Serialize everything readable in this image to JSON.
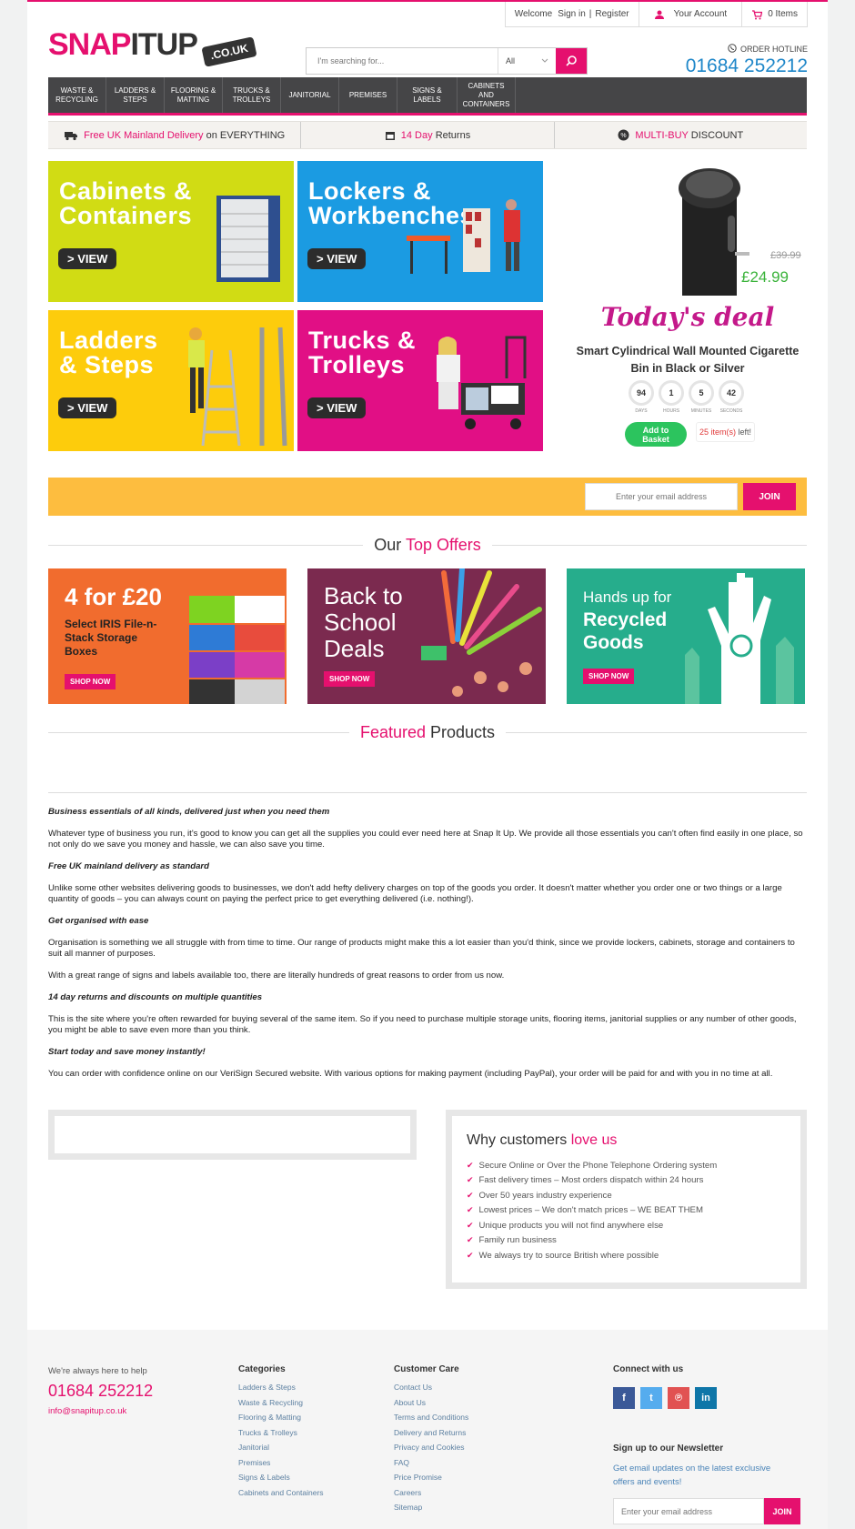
{
  "topbar": {
    "welcome": "Welcome",
    "sign_in": "Sign in",
    "sep": "|",
    "register": "Register",
    "account": "Your Account",
    "basket": "0 Items"
  },
  "logo": {
    "text_pink": "SNAP",
    "text_dark": "ITUP",
    "tag": ".CO.UK"
  },
  "search": {
    "placeholder": "I'm searching for...",
    "category": "All"
  },
  "hotline": {
    "label": "ORDER HOTLINE",
    "number": "01684 252212"
  },
  "nav": [
    {
      "l1": "WASTE &",
      "l2": "RECYCLING"
    },
    {
      "l1": "LADDERS &",
      "l2": "STEPS"
    },
    {
      "l1": "FLOORING &",
      "l2": "MATTING"
    },
    {
      "l1": "TRUCKS &",
      "l2": "TROLLEYS"
    },
    {
      "l1": "JANITORIAL",
      "l2": ""
    },
    {
      "l1": "PREMISES",
      "l2": ""
    },
    {
      "l1": "SIGNS & LABELS",
      "l2": ""
    },
    {
      "l1": "CABINETS AND",
      "l2": "CONTAINERS"
    }
  ],
  "usp": {
    "delivery_pink": "Free UK Mainland Delivery",
    "delivery_rest": "on EVERYTHING",
    "returns_pink": "14 Day",
    "returns_rest": "Returns",
    "multi_pink": "MULTI-BUY",
    "multi_rest": "DISCOUNT"
  },
  "tiles": [
    {
      "l1": "Cabinets &",
      "l2": "Containers",
      "view": "> VIEW",
      "color": "#d1dc14"
    },
    {
      "l1": "Lockers &",
      "l2": "Workbenches",
      "view": "> VIEW",
      "color": "#1b9be2"
    },
    {
      "l1": "Ladders",
      "l2": "& Steps",
      "view": "> VIEW",
      "color": "#fdcc0c"
    },
    {
      "l1": "Trucks &",
      "l2": "Trolleys",
      "view": "> VIEW",
      "color": "#e10f85"
    }
  ],
  "deal": {
    "old_price": "£39.99",
    "price": "£24.99",
    "title": "Today's deal",
    "name_l1": "Smart Cylindrical Wall Mounted Cigarette",
    "name_l2": "Bin in Black or Silver",
    "countdown": [
      {
        "v": "94",
        "l": "DAYS"
      },
      {
        "v": "1",
        "l": "HOURS"
      },
      {
        "v": "5",
        "l": "MINUTES"
      },
      {
        "v": "42",
        "l": "SECONDS"
      }
    ],
    "add_l1": "Add to",
    "add_l2": "Basket",
    "items_left": "25 item(s)",
    "left_word": "left!"
  },
  "newsletter": {
    "placeholder": "Enter your email address",
    "join": "JOIN"
  },
  "top_offers": {
    "w1": "Our",
    "w2": "Top Offers"
  },
  "offers": [
    {
      "t1": "4 for £20",
      "t2": "Select IRIS File-n-",
      "t3": "Stack Storage",
      "t4": "Boxes",
      "shop": "SHOP NOW",
      "color": "#f16c2e"
    },
    {
      "t1": "Back to",
      "t2": "School",
      "t3": "Deals",
      "shop": "SHOP NOW",
      "color": "#7b2a4f"
    },
    {
      "t1": "Hands up for",
      "t2": "Recycled",
      "t3": "Goods",
      "shop": "SHOP NOW",
      "color": "#26ad8c"
    }
  ],
  "featured": {
    "w1": "Featured",
    "w2": "Products"
  },
  "copy": {
    "h1": "Business essentials of all kinds, delivered just when you need them",
    "p1": "Whatever type of business you run, it's good to know you can get all the supplies you could ever need here at Snap It Up. We provide all those essentials you can't often find easily in one place, so not only do we save you money and hassle, we can also save you time.",
    "h2": "Free UK mainland delivery as standard",
    "p2": "Unlike some other websites delivering goods to businesses, we don't add hefty delivery charges on top of the goods you order. It doesn't matter whether you order one or two things or a large quantity of goods – you can always count on paying the perfect price to get everything delivered (i.e. nothing!).",
    "h3": "Get organised with ease",
    "p3": "Organisation is something we all struggle with from time to time. Our range of products might make this a lot easier than you'd think, since we provide lockers, cabinets, storage and containers to suit all manner of purposes.",
    "p4": "With a great range of signs and labels available too, there are literally hundreds of great reasons to order from us now.",
    "h4": "14 day returns and discounts on multiple quantities",
    "p5": "This is the site where you're often rewarded for buying several of the same item. So if you need to purchase multiple storage units, flooring items, janitorial supplies or any number of other goods, you might be able to save even more than you think.",
    "h5": "Start today and save money instantly!",
    "p6": "You can order with confidence online on our VeriSign Secured website. With various options for making payment (including PayPal), your order will be paid for and with you in no time at all."
  },
  "why": {
    "w1": "Why customers",
    "w2": "love us",
    "items": [
      "Secure Online or Over the Phone Telephone Ordering system",
      "Fast delivery times – Most orders dispatch within 24 hours",
      "Over 50 years industry experience",
      "Lowest prices – We don't match prices – WE BEAT THEM",
      "Unique products you will not find anywhere else",
      "Family run business",
      "We always try to source British where possible"
    ]
  },
  "footer": {
    "help": "We're always here to help",
    "phone": "01684 252212",
    "email": "info@snapitup.co.uk",
    "categories_title": "Categories",
    "categories": [
      "Ladders & Steps",
      "Waste & Recycling",
      "Flooring & Matting",
      "Trucks & Trolleys",
      "Janitorial",
      "Premises",
      "Signs & Labels",
      "Cabinets and Containers"
    ],
    "care_title": "Customer Care",
    "care": [
      "Contact Us",
      "About Us",
      "Terms and Conditions",
      "Delivery and Returns",
      "Privacy and Cookies",
      "FAQ",
      "Price Promise",
      "Careers",
      "Sitemap"
    ],
    "connect_title": "Connect with us",
    "social": [
      {
        "name": "facebook-icon",
        "glyph": "f",
        "color": "#3b5998"
      },
      {
        "name": "twitter-icon",
        "glyph": "t",
        "color": "#55acee"
      },
      {
        "name": "pinterest-icon",
        "glyph": "℗",
        "color": "#e15252"
      },
      {
        "name": "linkedin-icon",
        "glyph": "in",
        "color": "#0e76a8"
      }
    ],
    "signup_title": "Sign up to our Newsletter",
    "signup_text_l1": "Get email updates on the latest exclusive",
    "signup_text_l2": "offers and events!",
    "signup_placeholder": "Enter your email address",
    "signup_join": "JOIN"
  }
}
